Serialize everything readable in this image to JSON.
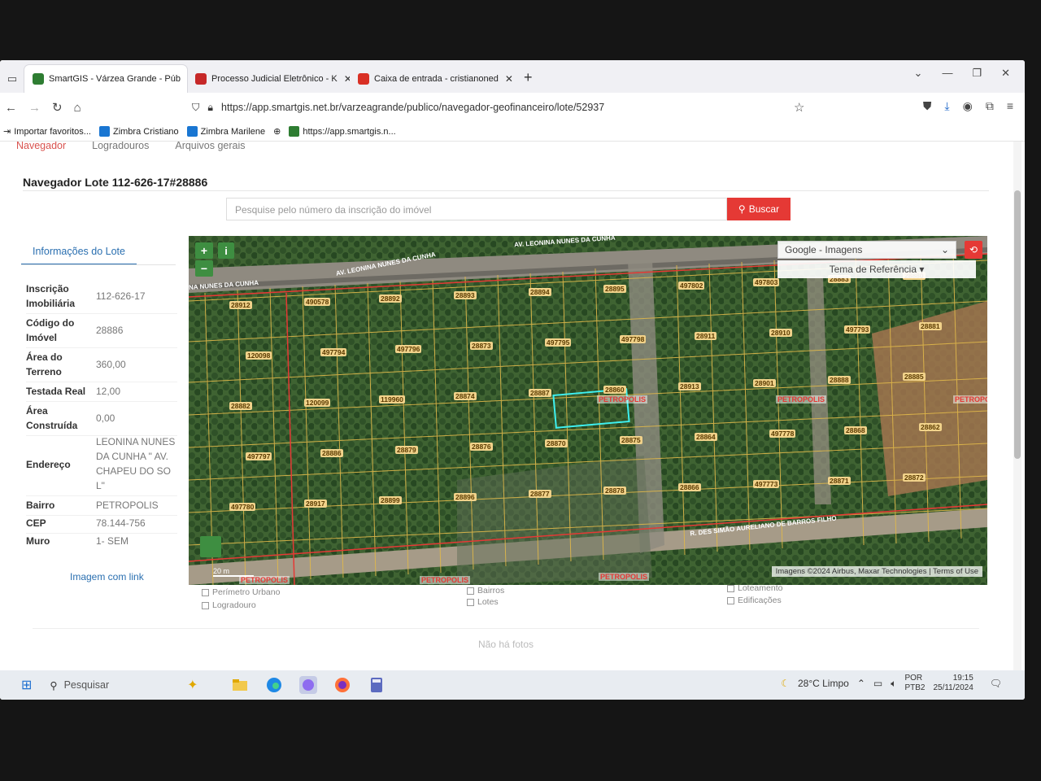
{
  "browser": {
    "tabs": [
      {
        "label": "SmartGIS - Várzea Grande - Púb",
        "color": "#2e7d32",
        "active": true
      },
      {
        "label": "Processo Judicial Eletrônico - K",
        "color": "#c62828",
        "active": false
      },
      {
        "label": "Caixa de entrada - cristianoned",
        "color": "#d93025",
        "active": false
      }
    ],
    "new_tab": "+",
    "url": "https://app.smartgis.net.br/varzeagrande/publico/navegador-geofinanceiro/lote/52937",
    "bookmarks": [
      "Importar favoritos...",
      "Zimbra Cristiano",
      "Zimbra Marilene",
      "https://app.smartgis.n..."
    ]
  },
  "app": {
    "tabs": [
      "Navegador",
      "Logradouros",
      "Arquivos gerais"
    ],
    "title": "Navegador Lote 112-626-17#28886",
    "search_placeholder": "Pesquise pelo número da inscrição do imóvel",
    "search_button": "Buscar",
    "info_tab": "Informações do Lote",
    "fields": [
      {
        "label": "Inscrição Imobiliária",
        "value": "112-626-17"
      },
      {
        "label": "Código do Imóvel",
        "value": "28886"
      },
      {
        "label": "Área do Terreno",
        "value": "360,00"
      },
      {
        "label": "Testada Real",
        "value": "12,00"
      },
      {
        "label": "Área Construída",
        "value": "0,00"
      },
      {
        "label": "Endereço",
        "value": "LEONINA NUNES DA CUNHA \" AV. CHAPEU DO SOL\""
      },
      {
        "label": "Bairro",
        "value": "PETROPOLIS"
      },
      {
        "label": "CEP",
        "value": "78.144-756"
      },
      {
        "label": "Muro",
        "value": "1- SEM"
      }
    ],
    "image_link": "Imagem com link",
    "map": {
      "layer": "Google - Imagens",
      "theme": "Tema de Referência",
      "attribution": "Imagens ©2024 Airbus, Maxar Technologies | Terms of Use",
      "scale": "20 m",
      "streets": [
        "AV. LEONINA NUNES DA CUNHA",
        "AV. LEONINA NUNES DA CUNHA",
        "NA NUNES DA CUNHA",
        "R. DES SIMÃO AURELIANO DE BARROS FILHO"
      ],
      "neighborhood_labels": [
        "PETROPOLIS",
        "PETROPOLIS",
        "PETROPOLIS",
        "PETROPOLIS",
        "PETROPOLIS",
        "PETROPOLIS"
      ],
      "lots": [
        "28912",
        "490578",
        "28892",
        "28893",
        "28894",
        "28895",
        "497802",
        "497803",
        "28883",
        "28880",
        "120098",
        "497794",
        "497796",
        "28873",
        "497795",
        "497798",
        "28911",
        "28910",
        "497793",
        "28881",
        "28882",
        "120099",
        "119960",
        "28874",
        "28887",
        "28860",
        "28913",
        "28901",
        "28888",
        "28885",
        "497797",
        "28886",
        "28879",
        "28876",
        "28870",
        "28875",
        "28864",
        "497778",
        "28868",
        "28862",
        "497780",
        "28917",
        "28899",
        "28896",
        "28877",
        "28878",
        "28866",
        "497773",
        "28871",
        "28872"
      ],
      "layer_list_left": [
        "Perímetro Urbano",
        "Logradouro"
      ],
      "layer_list_mid": [
        "Bairros",
        "Lotes"
      ],
      "layer_list_right": [
        "Loteamento",
        "Edificações"
      ]
    },
    "bottom_label": "Não há fotos"
  },
  "taskbar": {
    "search": "Pesquisar",
    "weather": "28°C Limpo",
    "lang": "POR",
    "lang2": "PTB2",
    "time": "19:15",
    "date": "25/11/2024"
  }
}
